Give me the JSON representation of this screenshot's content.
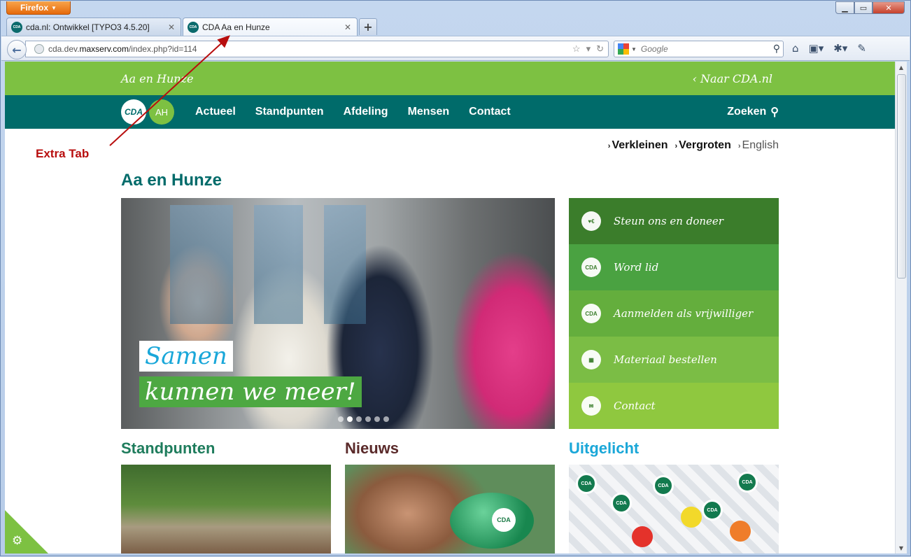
{
  "browser": {
    "menu_button": "Firefox",
    "tabs": [
      {
        "label": "cda.nl: Ontwikkel [TYPO3 4.5.20]",
        "favicon": "CDA"
      },
      {
        "label": "CDA Aa en Hunze",
        "favicon": "CDA"
      }
    ],
    "new_tab_icon": "+",
    "url_prefix": "cda.dev.",
    "url_domain": "maxserv.com",
    "url_path": "/index.php?id=114",
    "search_placeholder": "Google"
  },
  "site": {
    "location": "Aa en Hunze",
    "naar": "‹ Naar CDA.nl",
    "logo": "CDA",
    "badge": "AH",
    "nav": [
      "Actueel",
      "Standpunten",
      "Afdeling",
      "Mensen",
      "Contact"
    ],
    "search": "Zoeken",
    "size_links": {
      "smaller": "Verkleinen",
      "larger": "Vergroten",
      "english": "English"
    },
    "page_title": "Aa en Hunze",
    "hero": {
      "line1": "Samen",
      "line2": "kunnen we meer!",
      "slide_count": 6,
      "active_slide": 2
    },
    "actions": [
      {
        "label": "Steun ons en doneer",
        "icon": "heart-euro-icon"
      },
      {
        "label": "Word lid",
        "icon": "membership-card-icon"
      },
      {
        "label": "Aanmelden als vrijwilliger",
        "icon": "rosette-icon"
      },
      {
        "label": "Materiaal bestellen",
        "icon": "shop-icon"
      },
      {
        "label": "Contact",
        "icon": "phone-mail-icon"
      }
    ],
    "sections": {
      "standpunten": "Standpunten",
      "nieuws": "Nieuws",
      "uitgelicht": "Uitgelicht"
    },
    "pig_badge": "CDA",
    "candy_badge": "CDA"
  },
  "annotation": {
    "label": "Extra Tab"
  },
  "colors": {
    "green": "#7dc142",
    "teal": "#006b6a",
    "title_teal": "#006b6a",
    "annotation_red": "#b80e0e"
  }
}
